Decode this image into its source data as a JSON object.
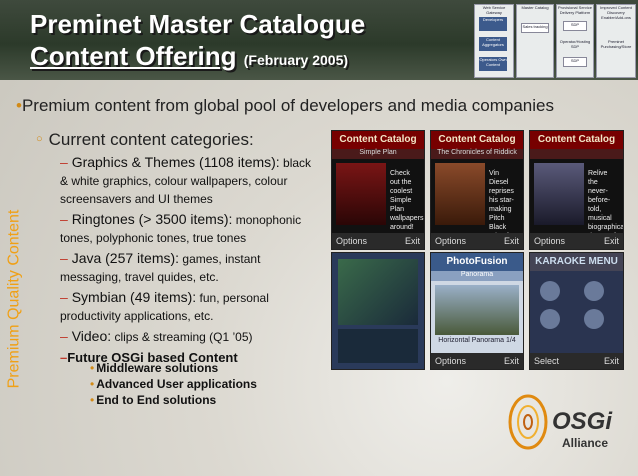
{
  "header": {
    "title_line1": "Preminet Master Catalogue",
    "title_line2": "Content Offering",
    "date": "(February 2005)"
  },
  "architecture_diagram": {
    "labels": [
      "Web Service Gateway",
      "Developers",
      "Master Catalog",
      "Provisional Service Delivery Platform",
      "Improved Content Discovery Enabler/Add-ons",
      "Content Aggregators",
      "Operators Own Content",
      "Sales tracking",
      "SDP",
      "Operator/Hosting SDP",
      "SDP",
      "Preminet Purchasing/Store"
    ]
  },
  "side_label": "Premium Quality Content",
  "main_bullet": "Premium content from global pool of developers and media companies",
  "sub_bullet": "Current content categories:",
  "categories": [
    {
      "main": "Graphics & Themes (1108 items):",
      "desc": " black & white graphics, colour wallpapers, colour screensavers and UI themes"
    },
    {
      "main": "Ringtones (> 3500 items):",
      "desc": " monophonic tones, polyphonic tones, true tones"
    },
    {
      "main": "Java (257 items):",
      "desc": " games, instant messaging, travel quides, etc."
    },
    {
      "main": "Symbian (49 items):",
      "desc": " fun, personal productivity applications, etc."
    },
    {
      "main": "Video:",
      "desc": " clips & streaming (Q1 ’05)"
    }
  ],
  "future": {
    "title": "Future OSGi based Content",
    "items": [
      "Middleware solutions",
      "Advanced User applications",
      "End to End solutions"
    ]
  },
  "screens": [
    {
      "title": "Content Catalog",
      "subtitle": "Simple Plan",
      "text": "Check out the coolest Simple Plan wallpapers around!",
      "left": "Options",
      "right": "Exit"
    },
    {
      "title": "Content Catalog",
      "subtitle": "The Chronicles of Riddick",
      "text": "Vin Diesel reprises his star-making Pitch Black role of the violent anti-hero Richard B. Riddick in this science fiction action",
      "left": "Options",
      "right": "Exit"
    },
    {
      "title": "Content Catalog",
      "subtitle": "",
      "text": "Relive the never-before-told, musical biographical drama of American legend Ray Charles. Featuring a remarkable performance from",
      "left": "Options",
      "right": "Exit"
    },
    {
      "title": "",
      "subtitle": "",
      "text": "",
      "left": "",
      "right": ""
    },
    {
      "title": "PhotoFusion",
      "subtitle": "Panorama",
      "text": "Horizontal Panorama 1/4",
      "left": "Options",
      "right": "Exit"
    },
    {
      "title": "KARAOKE MENU",
      "subtitle": "",
      "text": "",
      "left": "Select",
      "right": "Exit"
    }
  ],
  "logo": {
    "name": "OSGi",
    "tagline": "Alliance"
  },
  "colors": {
    "header": "#2c3a2a",
    "accent": "#d28a16",
    "side_label": "#f0a015",
    "bullet_dash": "#c0392b"
  }
}
